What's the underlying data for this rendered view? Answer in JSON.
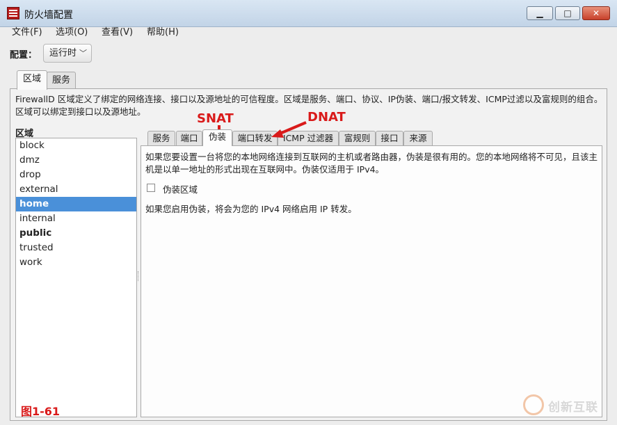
{
  "window": {
    "title": "防火墙配置"
  },
  "menu": [
    "文件(F)",
    "选项(O)",
    "查看(V)",
    "帮助(H)"
  ],
  "config": {
    "label": "配置：",
    "value": "运行时"
  },
  "top_tabs": [
    {
      "label": "区域",
      "active": true
    },
    {
      "label": "服务",
      "active": false
    }
  ],
  "zone_description": "FirewallD 区域定义了绑定的网络连接、接口以及源地址的可信程度。区域是服务、端口、协议、IP伪装、端口/报文转发、ICMP过滤以及富规则的组合。区域可以绑定到接口以及源地址。",
  "zones": {
    "heading": "区域",
    "items": [
      {
        "label": "block",
        "bold": false,
        "selected": false
      },
      {
        "label": "dmz",
        "bold": false,
        "selected": false
      },
      {
        "label": "drop",
        "bold": false,
        "selected": false
      },
      {
        "label": "external",
        "bold": false,
        "selected": false
      },
      {
        "label": "home",
        "bold": true,
        "selected": true
      },
      {
        "label": "internal",
        "bold": false,
        "selected": false
      },
      {
        "label": "public",
        "bold": true,
        "selected": false
      },
      {
        "label": "trusted",
        "bold": false,
        "selected": false
      },
      {
        "label": "work",
        "bold": false,
        "selected": false
      }
    ]
  },
  "inner_tabs": [
    {
      "label": "服务",
      "active": false
    },
    {
      "label": "端口",
      "active": false
    },
    {
      "label": "伪装",
      "active": true
    },
    {
      "label": "端口转发",
      "active": false
    },
    {
      "label": "ICMP 过滤器",
      "active": false
    },
    {
      "label": "富规则",
      "active": false
    },
    {
      "label": "接口",
      "active": false
    },
    {
      "label": "来源",
      "active": false
    }
  ],
  "masquerade": {
    "description": "如果您要设置一台将您的本地网络连接到互联网的主机或者路由器，伪装是很有用的。您的本地网络将不可见，且该主机是以单一地址的形式出现在互联网中。伪装仅适用于 IPv4。",
    "checkbox_label": "伪装区域",
    "checked": false,
    "note": "如果您启用伪装，将会为您的 IPv4 网络启用 IP 转发。"
  },
  "annotations": {
    "snat": "SNAT",
    "dnat": "DNAT",
    "color": "#d91a1a"
  },
  "figure_label": "图1-61",
  "watermark": {
    "text": "创新互联"
  },
  "colors": {
    "selection": "#4a90d9",
    "close_button": "#c8412b"
  },
  "icons": {
    "app": "firewall-wall-icon",
    "dropdown": "chevron-down-icon",
    "annotation": "red-arrow-icon"
  }
}
